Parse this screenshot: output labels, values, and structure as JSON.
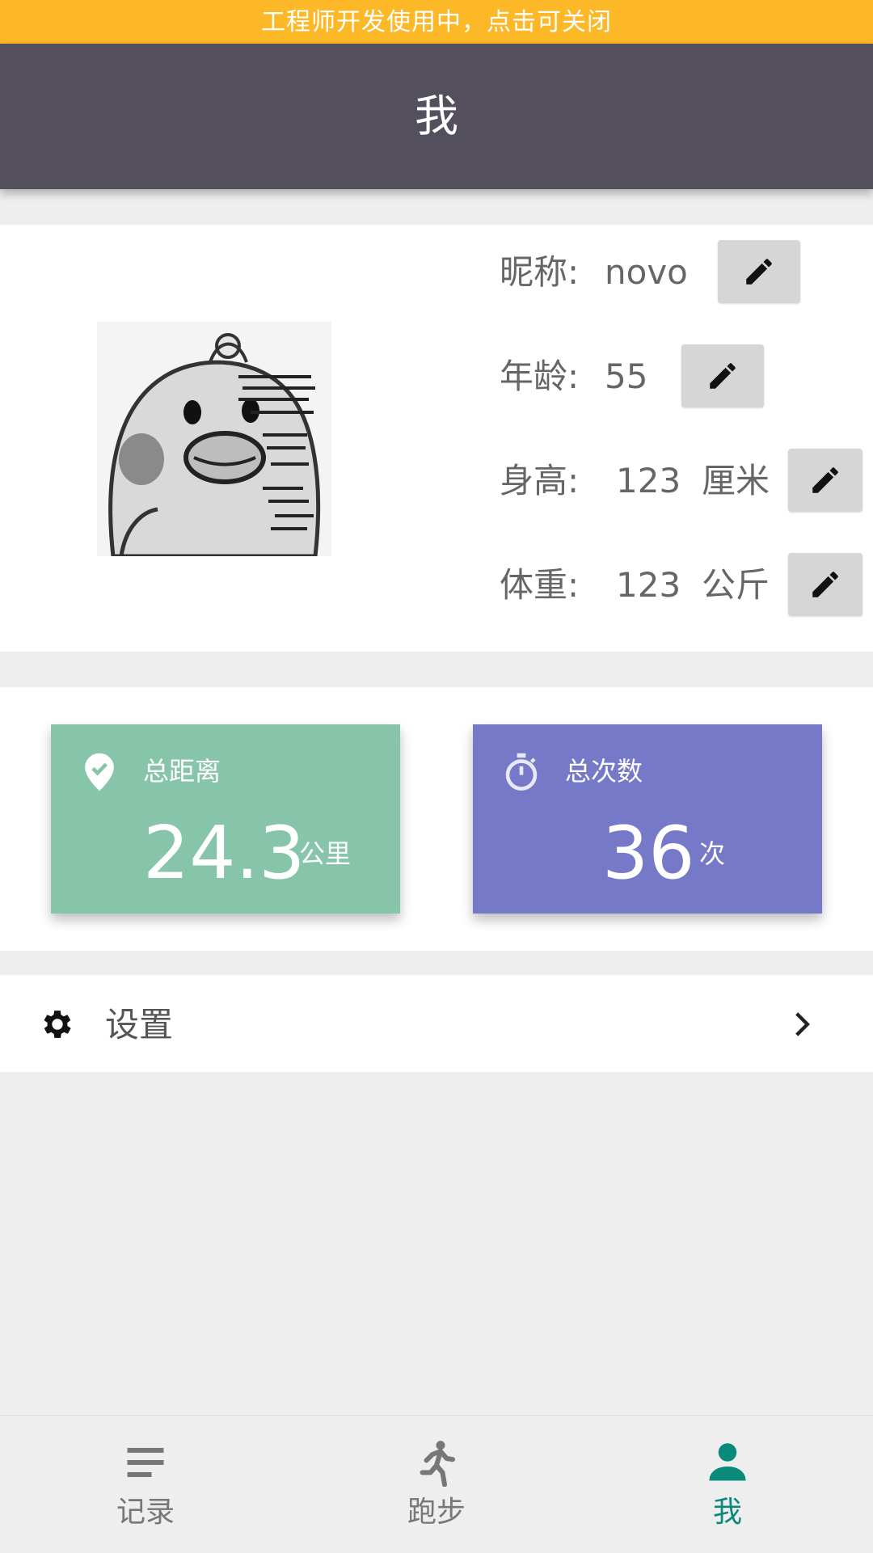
{
  "dev_banner": {
    "text": "工程师开发使用中，点击可关闭"
  },
  "app_bar": {
    "title": "我"
  },
  "profile": {
    "nickname": {
      "label": "昵称:",
      "value": "novo"
    },
    "age": {
      "label": "年龄:",
      "value": "55"
    },
    "height": {
      "label": "身高:",
      "value": "123",
      "unit": "厘米"
    },
    "weight": {
      "label": "体重:",
      "value": "123",
      "unit": "公斤"
    },
    "avatar_icon": "duck-sticker-avatar",
    "edit_icon": "pencil-icon"
  },
  "stats": {
    "distance": {
      "title": "总距离",
      "value": "24.3",
      "unit": "公里",
      "icon": "location-check-icon",
      "color": "#86c5aa"
    },
    "count": {
      "title": "总次数",
      "value": "36",
      "unit": "次",
      "icon": "stopwatch-icon",
      "color": "#7679c8"
    }
  },
  "settings": {
    "label": "设置",
    "icon": "gear-icon",
    "chevron": "chevron-right-icon"
  },
  "bottom_nav": {
    "items": [
      {
        "label": "记录",
        "icon": "list-icon"
      },
      {
        "label": "跑步",
        "icon": "running-icon"
      },
      {
        "label": "我",
        "icon": "person-icon",
        "active": true
      }
    ],
    "active_color": "#0a8a7b"
  },
  "colors": {
    "banner": "#fdb827",
    "app_bar": "#544f5c",
    "background": "#eeeeee"
  }
}
